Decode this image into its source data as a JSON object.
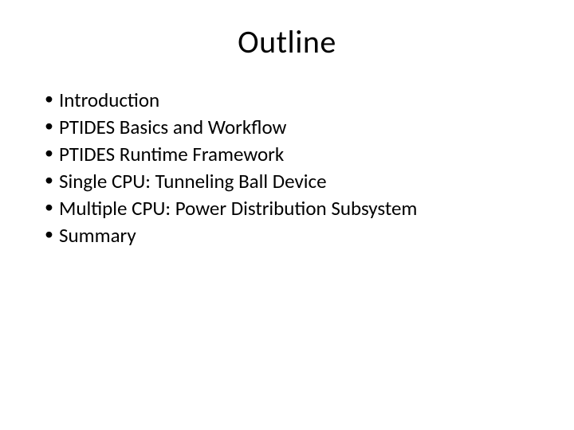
{
  "slide": {
    "title": "Outline",
    "bullets": [
      "Introduction",
      "PTIDES  Basics and Workflow",
      "PTIDES  Runtime Framework",
      "Single CPU:  Tunneling Ball Device",
      "Multiple CPU:  Power Distribution Subsystem",
      "Summary"
    ]
  }
}
